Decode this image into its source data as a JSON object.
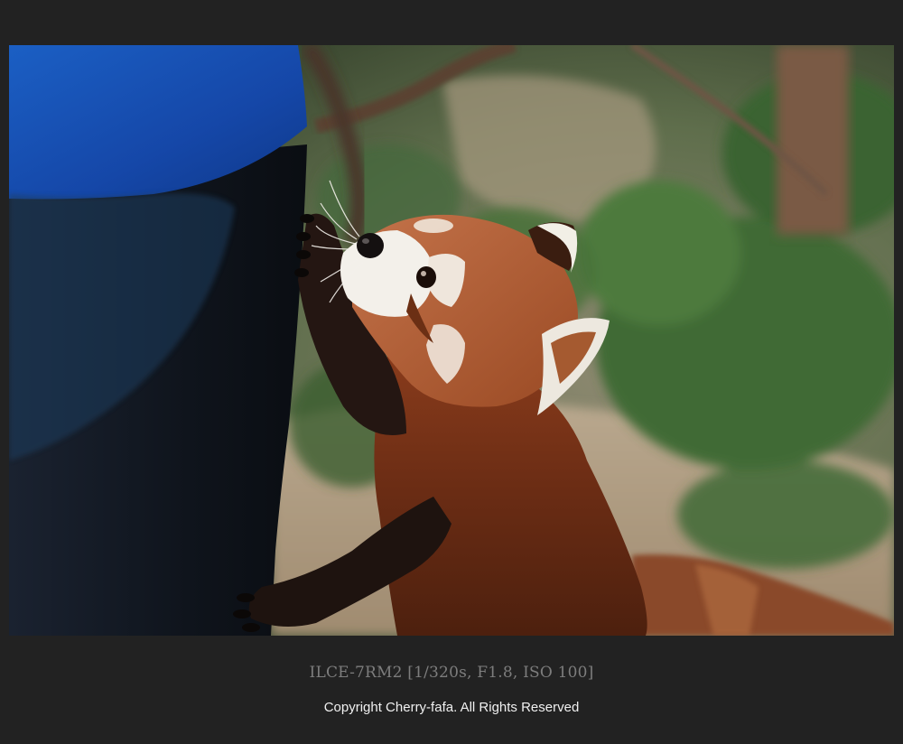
{
  "photo": {
    "subject": "red-panda-photo"
  },
  "caption": {
    "camera_info": "ILCE-7RM2 [1/320s, F1.8, ISO 100]",
    "copyright": "Copyright Cherry-fafa. All Rights Reserved"
  },
  "colors": {
    "background": "#222222",
    "caption_gray": "#7d7d7d",
    "caption_white": "#f0f0f0"
  }
}
